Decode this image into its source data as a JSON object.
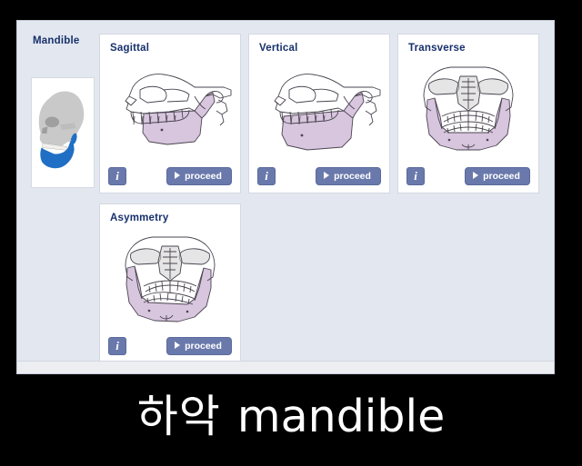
{
  "panel": {
    "region_label": "Mandible",
    "thumbnail": {
      "icon": "skull-lateral-mandible-highlight-icon",
      "cranium_color": "#c9c9c9",
      "mandible_color": "#1f6fc4"
    },
    "cards": [
      {
        "id": "sagittal",
        "title": "Sagittal",
        "figure_icon": "skull-lateral-sagittal-icon",
        "view": "lateral",
        "info_label": "i",
        "proceed_label": "proceed"
      },
      {
        "id": "vertical",
        "title": "Vertical",
        "figure_icon": "skull-lateral-vertical-icon",
        "view": "lateral",
        "info_label": "i",
        "proceed_label": "proceed"
      },
      {
        "id": "transverse",
        "title": "Transverse",
        "figure_icon": "skull-frontal-transverse-icon",
        "view": "frontal",
        "info_label": "i",
        "proceed_label": "proceed"
      },
      {
        "id": "asymmetry",
        "title": "Asymmetry",
        "figure_icon": "skull-frontal-asymmetry-icon",
        "view": "frontal",
        "info_label": "i",
        "proceed_label": "proceed"
      }
    ]
  },
  "caption": {
    "korean": "하악",
    "english": "mandible"
  },
  "colors": {
    "panel_background": "#e3e7ef",
    "card_background": "#ffffff",
    "title_text": "#17306b",
    "button_fill": "#6a79ab",
    "button_text": "#ffffff",
    "mandible_highlight": "#d8c5de",
    "bone_outline": "#4a4550",
    "page_background": "#000000",
    "caption_text": "#ffffff"
  }
}
